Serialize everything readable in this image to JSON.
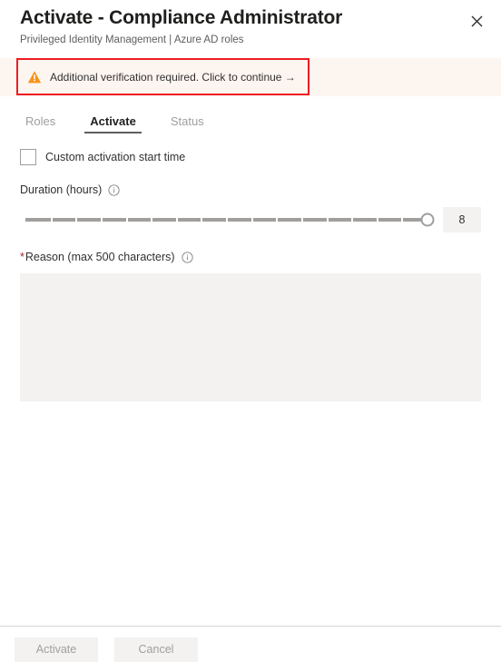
{
  "header": {
    "title": "Activate - Compliance Administrator",
    "subtitle": "Privileged Identity Management | Azure AD roles",
    "close_label": "✕"
  },
  "banner": {
    "icon": "warning-triangle-icon",
    "text": "Additional verification required. Click to continue →",
    "background_color": "#fdf5f0",
    "highlight_border_color": "#ed1c24",
    "icon_color": "#f7941d"
  },
  "tabs": [
    {
      "label": "Roles",
      "active": false
    },
    {
      "label": "Activate",
      "active": true
    },
    {
      "label": "Status",
      "active": false
    }
  ],
  "form": {
    "custom_start_time": {
      "label": "Custom activation start time",
      "checked": false
    },
    "duration": {
      "label": "Duration (hours)",
      "info_icon": "info-circle-icon",
      "value": "8",
      "min": 1,
      "max": 8,
      "segments": 16,
      "thumb_percent": 100
    },
    "reason": {
      "required_marker": "*",
      "label": "Reason (max 500 characters)",
      "info_icon": "info-circle-icon",
      "value": "",
      "placeholder": "",
      "max_characters": 500
    }
  },
  "footer": {
    "activate_label": "Activate",
    "cancel_label": "Cancel",
    "activate_disabled": true,
    "cancel_disabled": true
  }
}
